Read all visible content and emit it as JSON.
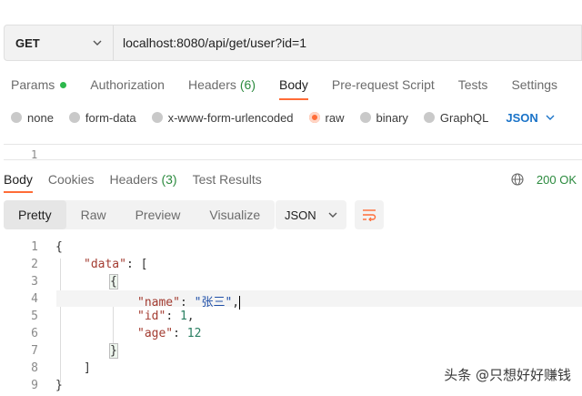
{
  "request": {
    "method": "GET",
    "url": "localhost:8080/api/get/user?id=1"
  },
  "request_tabs": [
    {
      "label": "Params"
    },
    {
      "label": "Authorization"
    },
    {
      "label": "Headers",
      "count": "(6)"
    },
    {
      "label": "Body"
    },
    {
      "label": "Pre-request Script"
    },
    {
      "label": "Tests"
    },
    {
      "label": "Settings"
    }
  ],
  "body_types": [
    {
      "label": "none"
    },
    {
      "label": "form-data"
    },
    {
      "label": "x-www-form-urlencoded"
    },
    {
      "label": "raw"
    },
    {
      "label": "binary"
    },
    {
      "label": "GraphQL"
    }
  ],
  "body_format": "JSON",
  "request_editor": {
    "line_number": "1"
  },
  "response_tabs": [
    {
      "label": "Body"
    },
    {
      "label": "Cookies"
    },
    {
      "label": "Headers",
      "count": "(3)"
    },
    {
      "label": "Test Results"
    }
  ],
  "status": "200 OK",
  "view_modes": [
    "Pretty",
    "Raw",
    "Preview",
    "Visualize"
  ],
  "response_format": "JSON",
  "code": {
    "line_numbers": [
      "1",
      "2",
      "3",
      "4",
      "5",
      "6",
      "7",
      "8",
      "9"
    ],
    "l1": "{",
    "l2_key": "\"data\"",
    "l2_rest": ": [",
    "l3": "{",
    "l4_key": "\"name\"",
    "l4_colon": ": ",
    "l4_val": "\"张三\"",
    "l4_end": ",",
    "l5_key": "\"id\"",
    "l5_colon": ": ",
    "l5_val": "1",
    "l5_end": ",",
    "l6_key": "\"age\"",
    "l6_colon": ": ",
    "l6_val": "12",
    "l7": "}",
    "l8": "]",
    "l9": "}"
  },
  "watermark": "头条 @只想好好赚钱",
  "colors": {
    "accent": "#ff6c37",
    "status_green": "#2b8a3e",
    "link_blue": "#1a73c8"
  }
}
